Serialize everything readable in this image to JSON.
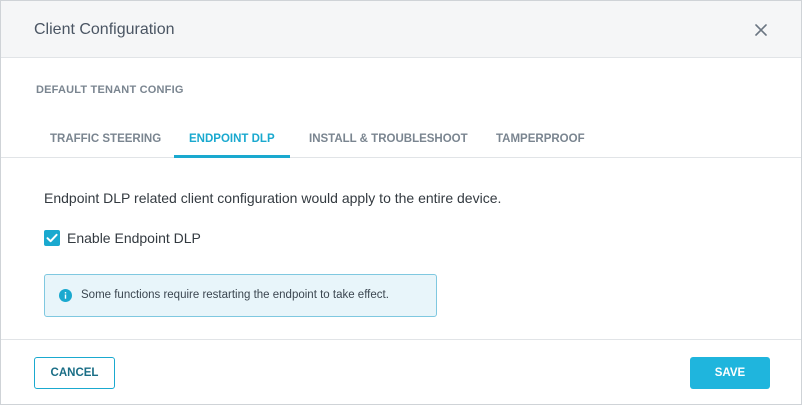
{
  "dialog": {
    "title": "Client Configuration",
    "close_icon": "close-icon"
  },
  "tenant": {
    "label": "DEFAULT TENANT CONFIG"
  },
  "tabs": [
    {
      "label": "TRAFFIC STEERING",
      "active": false
    },
    {
      "label": "ENDPOINT DLP",
      "active": true
    },
    {
      "label": "INSTALL & TROUBLESHOOT",
      "active": false
    },
    {
      "label": "TAMPERPROOF",
      "active": false
    }
  ],
  "content": {
    "description": "Endpoint DLP related client configuration would apply to the entire device.",
    "checkbox": {
      "label": "Enable Endpoint DLP",
      "checked": true
    },
    "info": {
      "icon": "info-icon",
      "text": "Some functions require restarting the endpoint to take effect."
    }
  },
  "footer": {
    "cancel_label": "CANCEL",
    "save_label": "SAVE"
  },
  "colors": {
    "accent": "#1aa9cf",
    "save_bg": "#1fb5dd",
    "info_bg": "#e8f5fa",
    "header_bg": "#f5f6f7"
  }
}
